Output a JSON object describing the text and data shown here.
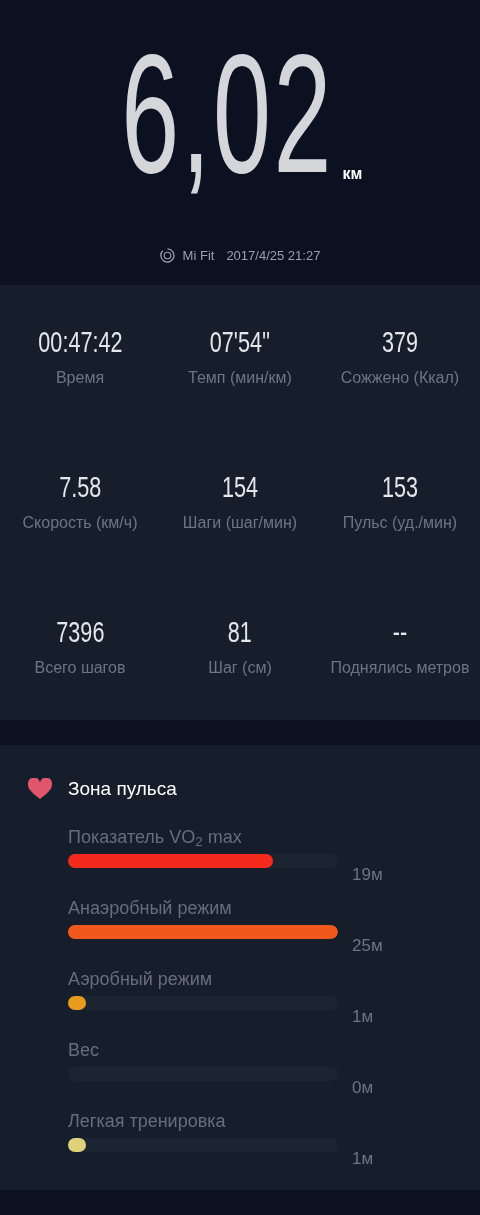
{
  "distance": {
    "value": "6,02",
    "unit": "км"
  },
  "source": {
    "app": "Mi Fit",
    "datetime": "2017/4/25 21:27"
  },
  "stats": [
    {
      "value": "00:47:42",
      "label": "Время"
    },
    {
      "value": "07'54''",
      "label": "Темп (мин/км)"
    },
    {
      "value": "379",
      "label": "Сожжено (Ккал)"
    },
    {
      "value": "7.58",
      "label": "Скорость (км/ч)"
    },
    {
      "value": "154",
      "label": "Шаги (шаг/мин)"
    },
    {
      "value": "153",
      "label": "Пульс (уд./мин)"
    },
    {
      "value": "7396",
      "label": "Всего шагов"
    },
    {
      "value": "81",
      "label": "Шаг (см)"
    },
    {
      "value": "--",
      "label": "Поднялись метров"
    }
  ],
  "heart_zone": {
    "title": "Зона пульса",
    "zones": [
      {
        "label": "Показатель VO$_{2}$ max",
        "level": 0.76,
        "reading": "19м",
        "color": "#f52a1d"
      },
      {
        "label": "Анаэробный режим",
        "level": 1,
        "reading": "25м",
        "color": "#f0581c"
      },
      {
        "label": "Аэробный режим",
        "level": 0.065,
        "reading": "1м",
        "color": "#e89c1e"
      },
      {
        "label": "Вес",
        "reading": "0м"
      },
      {
        "label": "Легкая тренировка",
        "level": 0.065,
        "reading": "1м",
        "color": "#e0d27a"
      }
    ]
  }
}
